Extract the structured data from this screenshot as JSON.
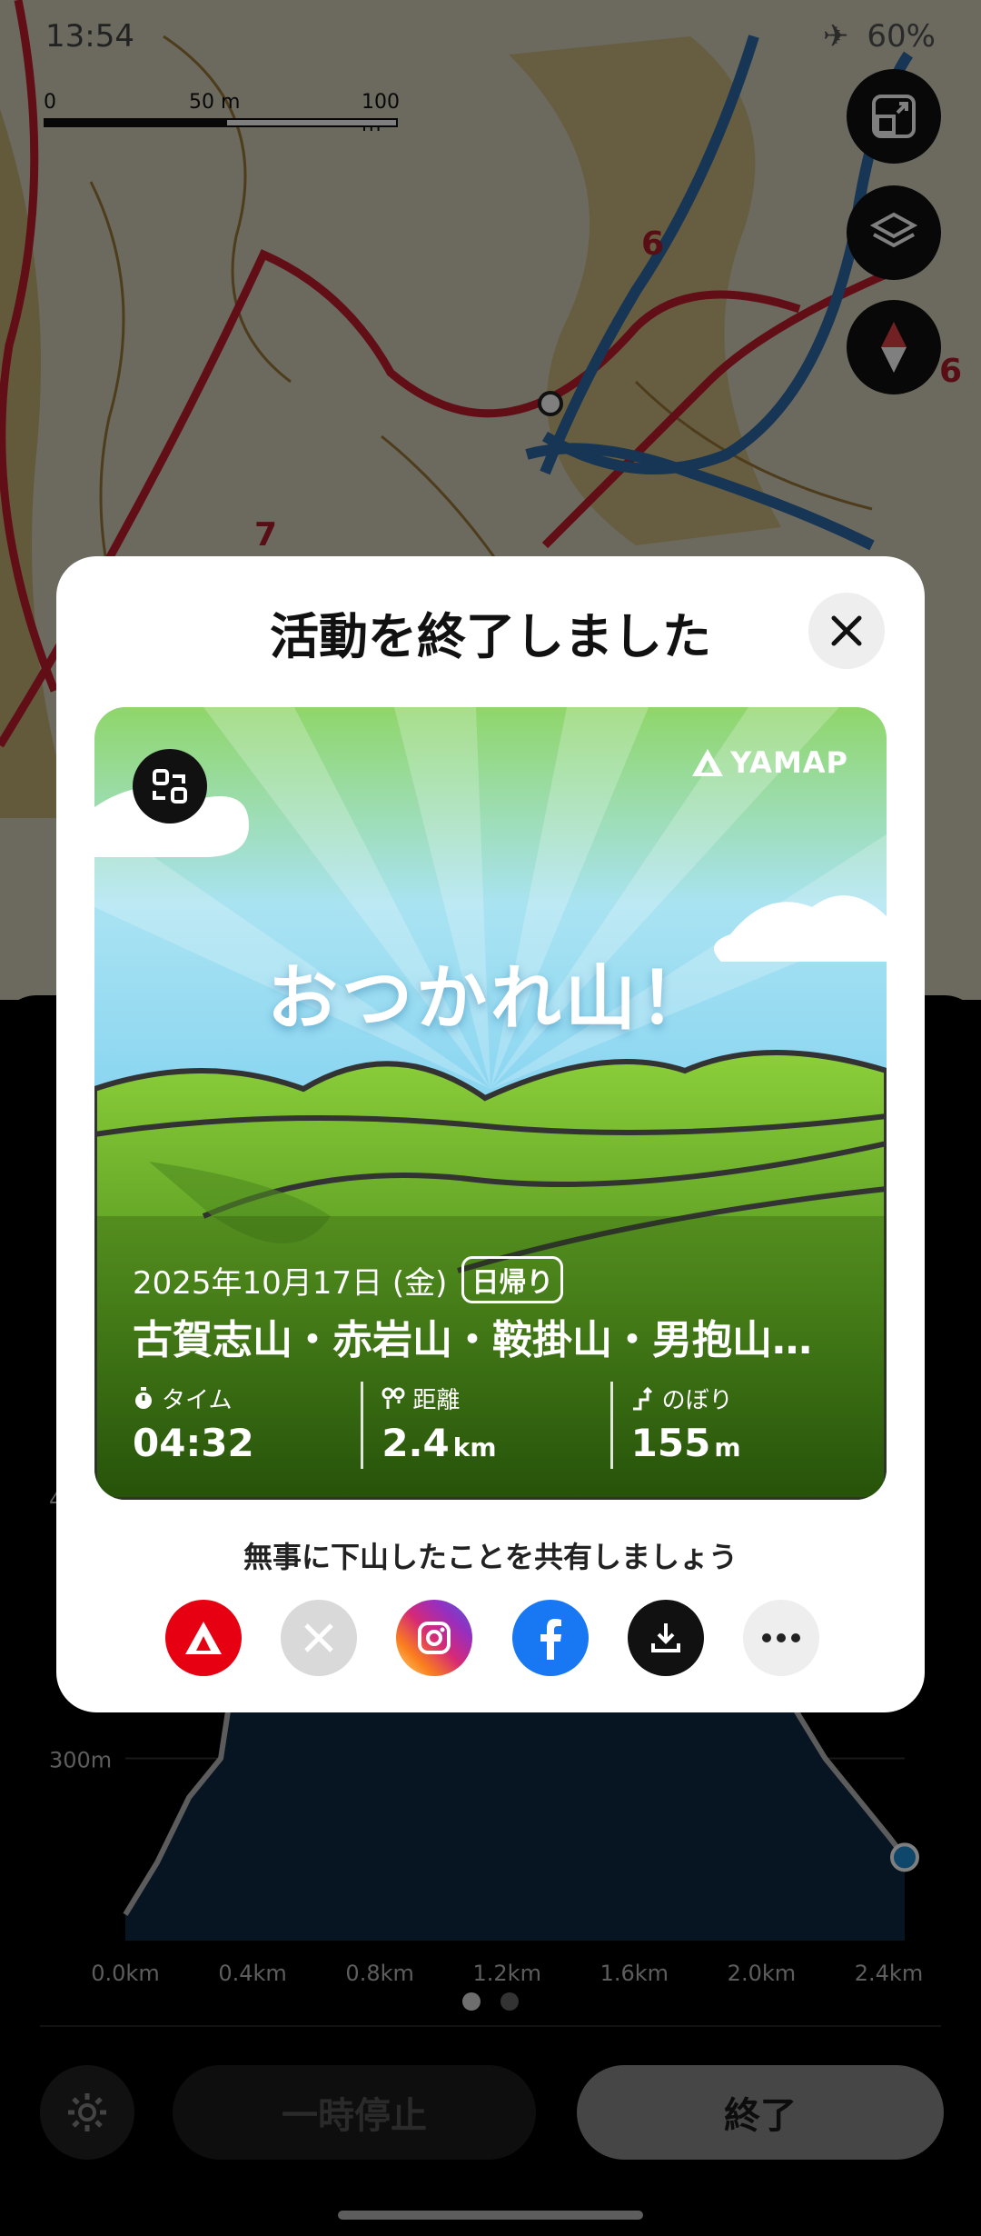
{
  "status_bar": {
    "time": "13:54",
    "battery": "60%"
  },
  "map": {
    "scale_labels": [
      "0",
      "50 m",
      "100 m"
    ],
    "markers": [
      "6",
      "6",
      "7"
    ]
  },
  "chart_data": {
    "type": "area",
    "x": [
      0.0,
      0.1,
      0.2,
      0.3,
      0.4,
      0.5,
      0.6,
      0.7,
      0.8,
      0.9,
      1.0,
      1.1,
      1.2,
      1.3,
      1.4,
      1.5,
      1.6,
      1.7,
      1.8,
      1.9,
      2.0,
      2.1,
      2.2,
      2.3,
      2.4,
      2.45
    ],
    "y": [
      240,
      260,
      285,
      300,
      380,
      395,
      500,
      530,
      540,
      545,
      540,
      520,
      500,
      470,
      445,
      420,
      405,
      390,
      370,
      355,
      340,
      320,
      300,
      285,
      270,
      262
    ],
    "xticks": [
      "0.0km",
      "0.4km",
      "0.8km",
      "1.2km",
      "1.6km",
      "2.0km",
      "2.4km"
    ],
    "yticks": [
      "300m",
      "400m"
    ],
    "xlim": [
      0.0,
      2.45
    ],
    "ylim": [
      230,
      560
    ]
  },
  "bottom": {
    "pause_label": "一時停止",
    "end_label": "終了"
  },
  "modal": {
    "title": "活動を終了しました",
    "card": {
      "brand": "YAMAP",
      "headline": "おつかれ山！",
      "date": "2025年10月17日 (金)",
      "trip_type": "日帰り",
      "mountains": "古賀志山・赤岩山・鞍掛山・男抱山…",
      "stats": [
        {
          "label": "タイム",
          "value": "04:32",
          "unit": ""
        },
        {
          "label": "距離",
          "value": "2.4",
          "unit": "km"
        },
        {
          "label": "のぼり",
          "value": "155",
          "unit": "m"
        }
      ]
    },
    "share_text": "無事に下山したことを共有しましょう",
    "share_buttons": [
      {
        "name": "yamap",
        "color": "#e60012"
      },
      {
        "name": "x",
        "color": "#d9d9d9"
      },
      {
        "name": "instagram",
        "color": "#d62976"
      },
      {
        "name": "facebook",
        "color": "#1877f2"
      },
      {
        "name": "download",
        "color": "#111111"
      },
      {
        "name": "more",
        "color": "#eeeeee"
      }
    ]
  }
}
